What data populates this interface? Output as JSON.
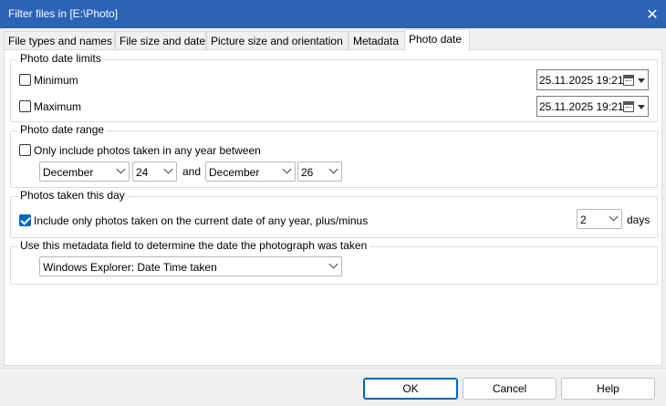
{
  "window": {
    "title": "Filter files in [E:\\Photo]"
  },
  "tabs": [
    {
      "label": "File types and names"
    },
    {
      "label": "File size and date"
    },
    {
      "label": "Picture size and orientation"
    },
    {
      "label": "Metadata"
    },
    {
      "label": "Photo date"
    }
  ],
  "limits": {
    "legend": "Photo date limits",
    "minimum": {
      "label": "Minimum",
      "checked": false,
      "value": "25.11.2025 19:21"
    },
    "maximum": {
      "label": "Maximum",
      "checked": false,
      "value": "25.11.2025 19:21"
    }
  },
  "range": {
    "legend": "Photo date range",
    "checkbox_label": "Only include photos taken in any year between",
    "checked": false,
    "from_month": "December",
    "from_day": "24",
    "and_label": "and",
    "to_month": "December",
    "to_day": "26"
  },
  "today": {
    "legend": "Photos taken this day",
    "checkbox_label": "Include only photos taken on the current date of any year, plus/minus",
    "checked": true,
    "days_value": "2",
    "days_label": "days"
  },
  "metadata_field": {
    "legend": "Use this metadata field to determine the date the photograph was taken",
    "value": "Windows Explorer: Date Time taken"
  },
  "buttons": {
    "ok": "OK",
    "cancel": "Cancel",
    "help": "Help"
  },
  "colors": {
    "titlebar": "#2b63b6",
    "accent": "#0067c0"
  }
}
